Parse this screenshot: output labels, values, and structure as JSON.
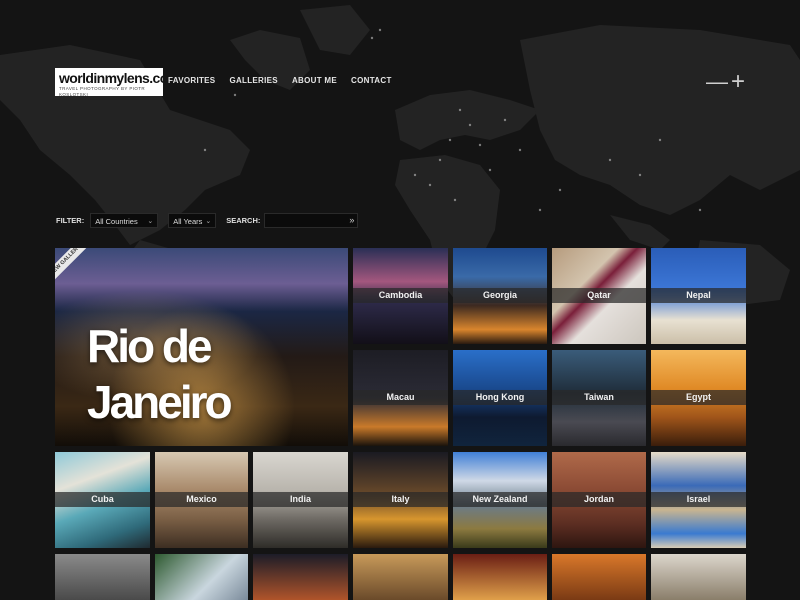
{
  "header": {
    "logo_title": "worldinmylens.com",
    "logo_subtitle": "TRAVEL PHOTOGRAPHY BY PIOTR KOSLOTSKI",
    "nav": [
      "FAVORITES",
      "GALLERIES",
      "ABOUT ME",
      "CONTACT"
    ],
    "zoom_out": "—",
    "zoom_in": "+"
  },
  "filter": {
    "label": "FILTER:",
    "country_value": "All Countries",
    "year_value": "All Years",
    "search_label": "SEARCH:",
    "search_value": "",
    "search_go": "»"
  },
  "featured": {
    "ribbon": "NEW GALLERY",
    "title": "Rio de Janeiro"
  },
  "galleries": [
    "Cambodia",
    "Georgia",
    "Qatar",
    "Nepal",
    "Macau",
    "Hong Kong",
    "Taiwan",
    "Egypt",
    "Cuba",
    "Mexico",
    "India",
    "Italy",
    "New Zealand",
    "Jordan",
    "Israel"
  ],
  "colors": {
    "background": "#161616",
    "map_land": "#262626",
    "tile_label_bg": "#282828"
  }
}
